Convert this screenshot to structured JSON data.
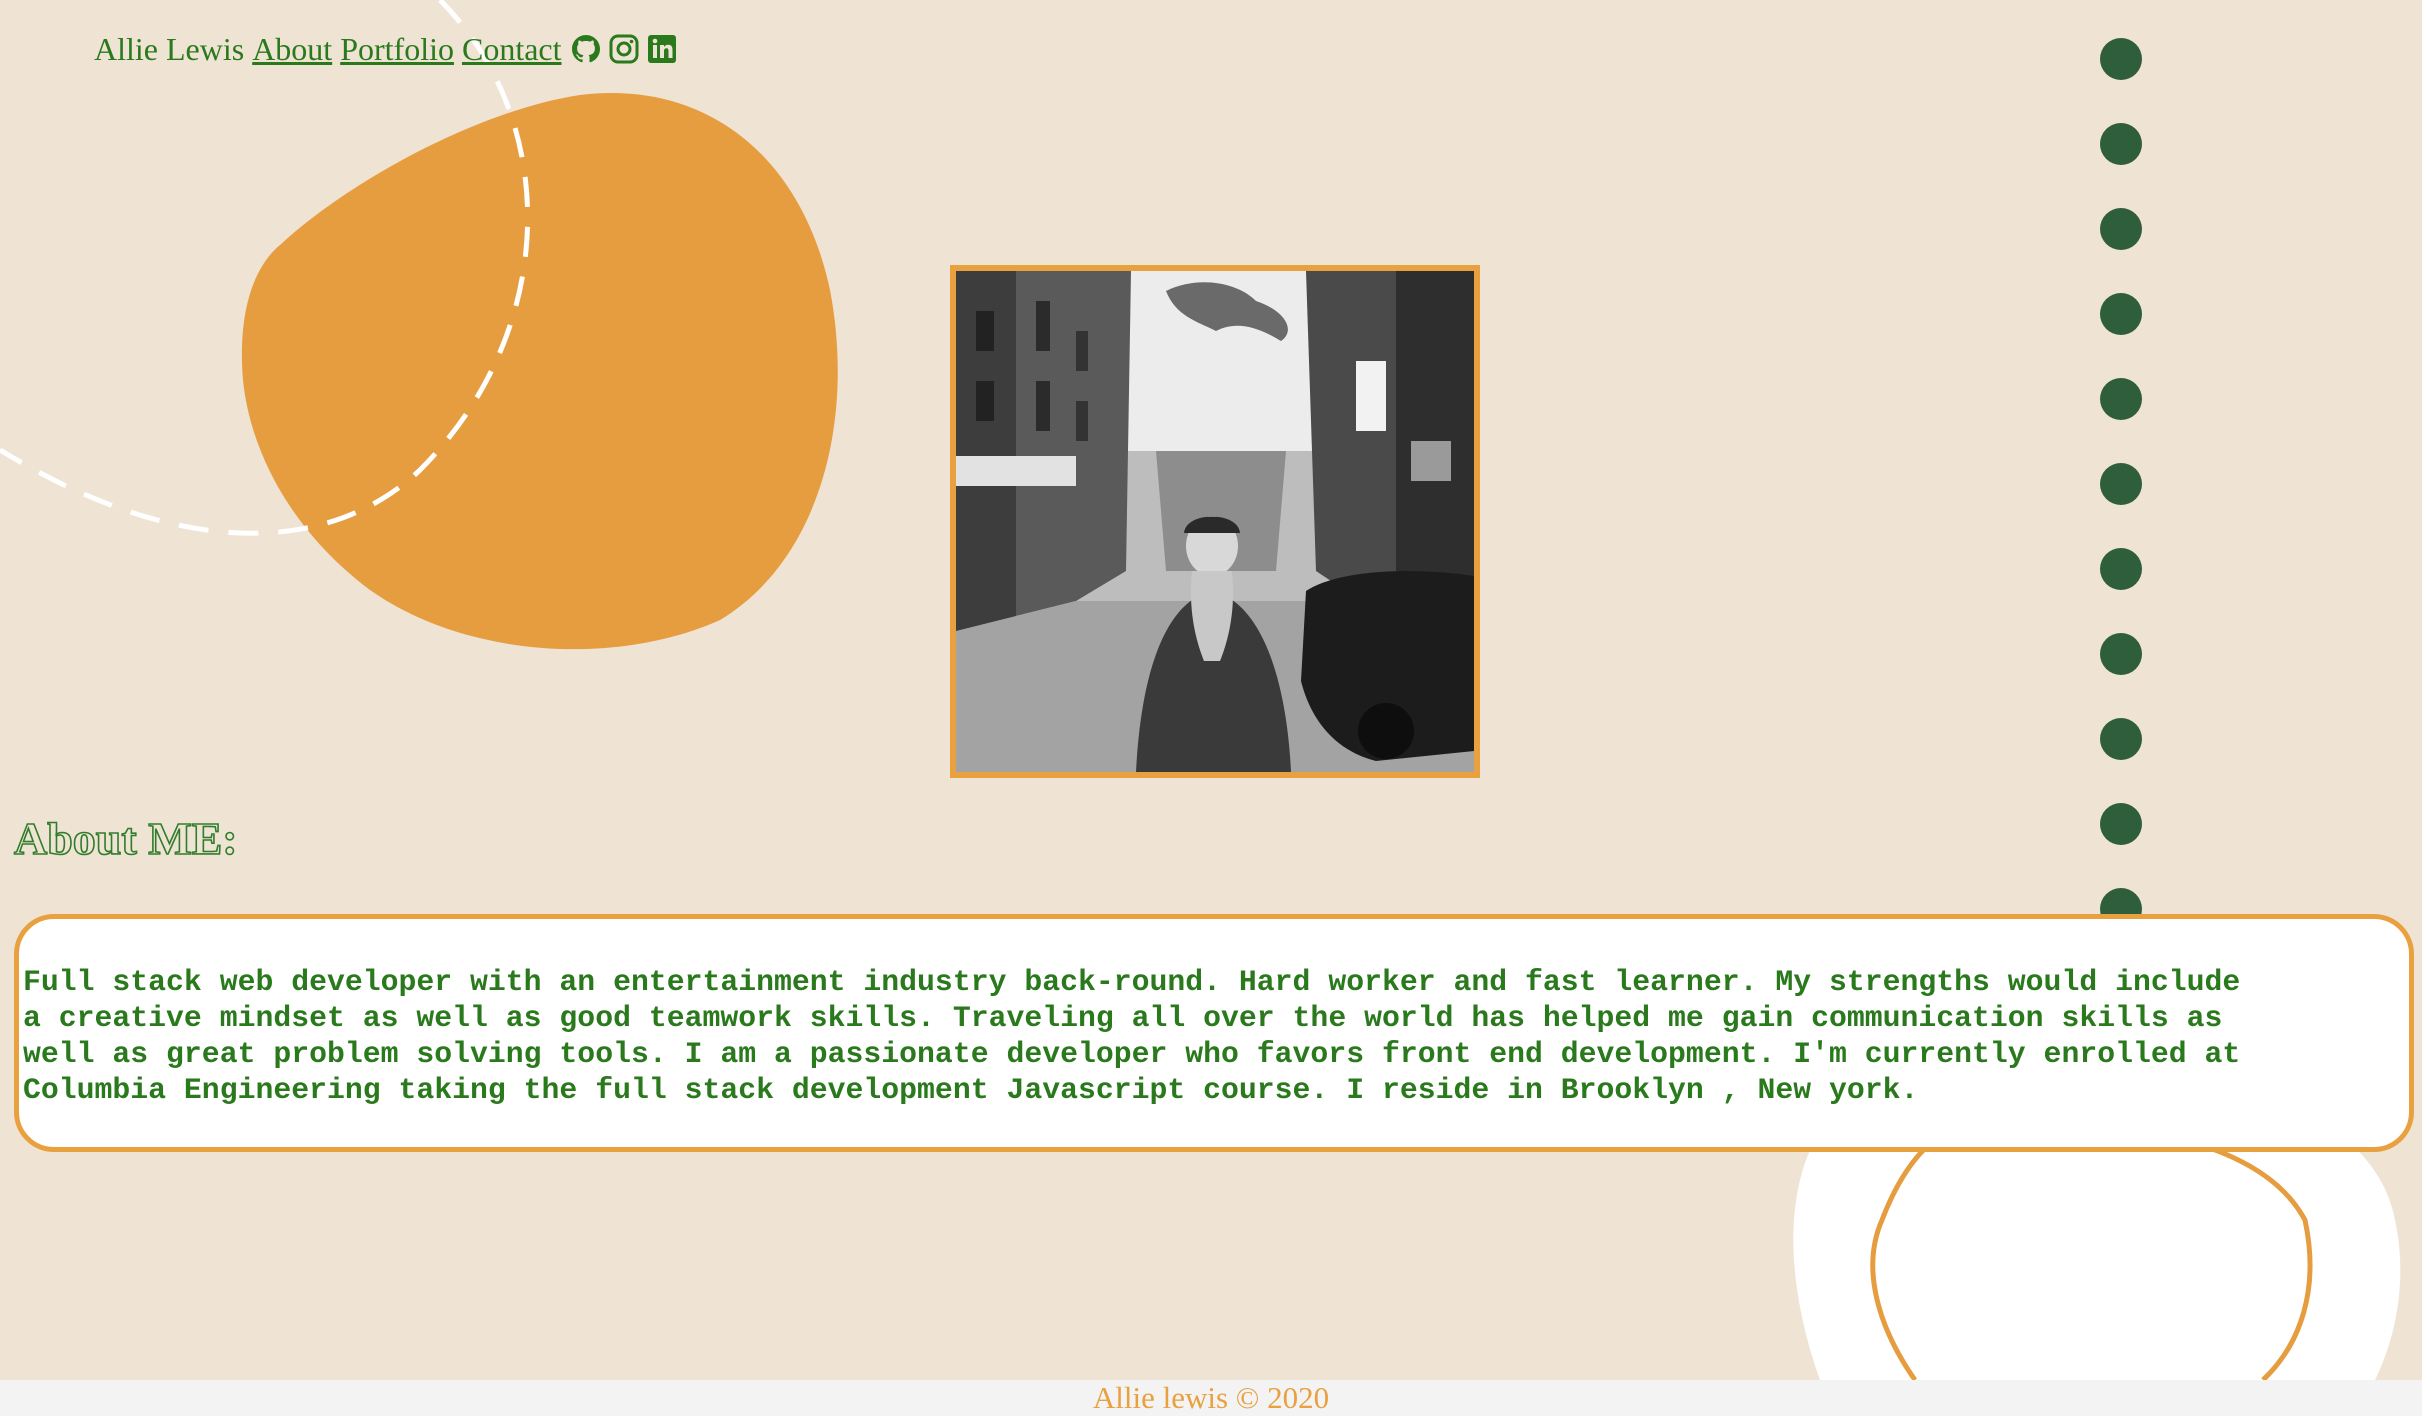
{
  "header": {
    "brand": "Allie Lewis",
    "nav": [
      {
        "label": "About"
      },
      {
        "label": "Portfolio"
      },
      {
        "label": "Contact"
      }
    ],
    "social_icons": [
      "github-icon",
      "instagram-icon",
      "linkedin-icon"
    ]
  },
  "about": {
    "heading": "About ME:",
    "lines": [
      "Full stack web developer with an entertainment industry back-round. Hard worker and fast learner. My strengths would include",
      "a creative mindset as well as good teamwork skills. Traveling all over the world has helped me gain communication skills as",
      "well as great problem solving tools. I am a passionate developer who favors front end development. I'm currently enrolled at",
      "Columbia Engineering taking the full stack development Javascript course. I reside in Brooklyn , New york."
    ]
  },
  "footer": {
    "text": "Allie lewis © 2020"
  },
  "colors": {
    "background": "#efe3d4",
    "accent_orange": "#e9a03f",
    "text_green": "#2a7a1d",
    "dot_green": "#2f5e3c",
    "panel_white": "#ffffff"
  }
}
